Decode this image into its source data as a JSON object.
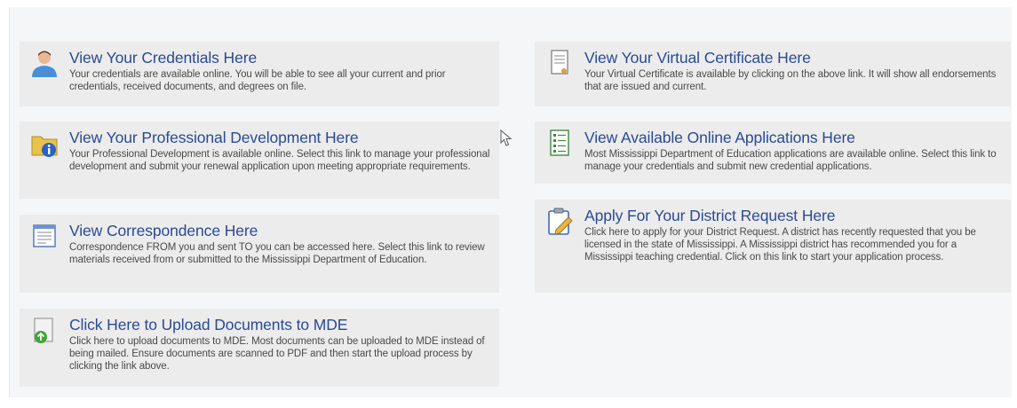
{
  "cards": [
    {
      "title": "View Your Credentials Here",
      "description": "Your credentials are available online. You will be able to see all your current and prior credentials, received documents, and degrees on file.",
      "icon": "user-icon"
    },
    {
      "title": "View Your Virtual Certificate Here",
      "description": "Your Virtual Certificate is available by clicking on the above link. It will show all endorsements that are issued and current.",
      "icon": "certificate-icon"
    },
    {
      "title": "View Your Professional Development Here",
      "description": "Your Professional Development is available online. Select this link to manage your professional development and submit your renewal application upon meeting appropriate requirements.",
      "icon": "folder-info-icon"
    },
    {
      "title": "View Available Online Applications Here",
      "description": "Most Mississippi Department of Education applications are available online. Select this link to manage your credentials and submit new credential applications.",
      "icon": "application-list-icon"
    },
    {
      "title": "View Correspondence Here",
      "description": "Correspondence FROM you and sent TO you can be accessed here. Select this link to review materials received from or submitted to the Mississippi Department of Education.",
      "icon": "document-icon"
    },
    {
      "title": "Apply For Your District Request Here",
      "description": "Click here to apply for your District Request. A district has recently requested that you be licensed in the state of Mississippi. A Mississippi district has recommended you for a Mississippi teaching credential. Click on this link to start your application process.",
      "icon": "clipboard-edit-icon"
    },
    {
      "title": "Click Here to Upload Documents to MDE",
      "description": "Click here to upload documents to MDE. Most documents can be uploaded to MDE instead of being mailed. Ensure documents are scanned to PDF and then start the upload process by clicking the link above.",
      "icon": "upload-document-icon"
    }
  ],
  "colors": {
    "link": "#2a4a94",
    "text": "#4a4a4a",
    "card_bg": "#ececec",
    "panel_bg": "#f5f6f8"
  }
}
